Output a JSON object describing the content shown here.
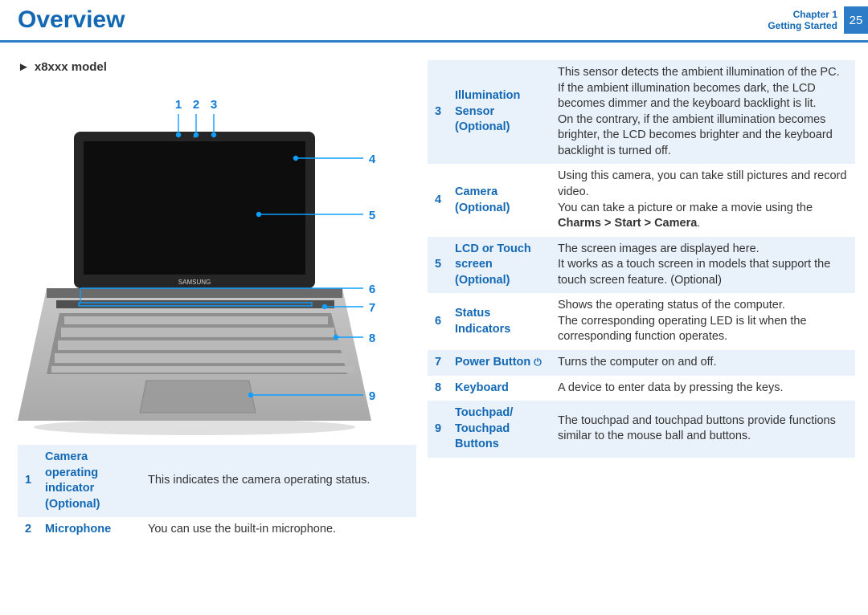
{
  "header": {
    "title": "Overview",
    "chapter": "Chapter 1",
    "section": "Getting Started",
    "page": "25"
  },
  "model_heading": "x8xxx model",
  "callouts": [
    "1",
    "2",
    "3",
    "4",
    "5",
    "6",
    "7",
    "8",
    "9"
  ],
  "left_table": [
    {
      "num": "1",
      "label": "Camera operating indicator (Optional)",
      "desc": "This indicates the camera operating status."
    },
    {
      "num": "2",
      "label": "Microphone",
      "desc": "You can use the built-in microphone."
    }
  ],
  "right_table": [
    {
      "num": "3",
      "label": "Illumination Sensor (Optional)",
      "desc": "This sensor detects the ambient illumination of the PC.\nIf the ambient illumination becomes dark, the LCD becomes dimmer and the keyboard backlight is lit.\nOn the contrary, if the ambient illumination becomes brighter, the LCD becomes brighter and the keyboard backlight is turned off."
    },
    {
      "num": "4",
      "label": "Camera (Optional)",
      "desc_a": "Using this camera, you can take still pictures and record video.",
      "desc_b": "You can take a picture or make a movie using the ",
      "desc_bold": "Charms > Start > Camera",
      "desc_c": "."
    },
    {
      "num": "5",
      "label": "LCD or Touch screen (Optional)",
      "desc": "The screen images are displayed here.\nIt works as a touch screen in models that support the touch screen feature. (Optional)"
    },
    {
      "num": "6",
      "label": "Status Indicators",
      "desc": "Shows the operating status of the computer.\nThe corresponding operating LED is lit when the corresponding function operates."
    },
    {
      "num": "7",
      "label": "Power Button ",
      "icon": "power",
      "desc": "Turns the computer on and off."
    },
    {
      "num": "8",
      "label": "Keyboard",
      "desc": "A device to enter data by pressing the keys."
    },
    {
      "num": "9",
      "label": "Touchpad/ Touchpad Buttons",
      "desc": "The touchpad and touchpad buttons provide functions similar to the mouse ball and buttons."
    }
  ]
}
